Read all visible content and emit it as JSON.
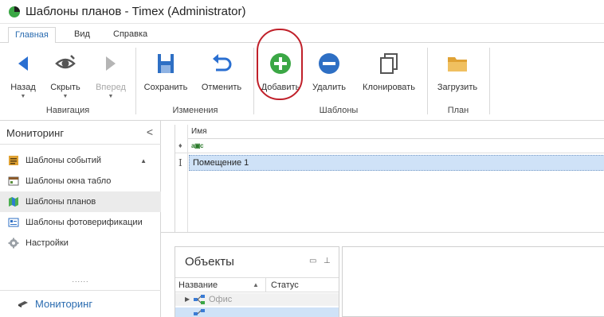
{
  "window": {
    "title": "Шаблоны планов - Timex (Administrator)"
  },
  "menu": {
    "tabs": [
      "Главная",
      "Вид",
      "Справка"
    ],
    "active": "Главная"
  },
  "ribbon": {
    "groups": [
      {
        "label": "Навигация",
        "buttons": [
          {
            "label": "Назад",
            "icon": "arrow-left-icon",
            "enabled": true,
            "dropdown": true
          },
          {
            "label": "Скрыть",
            "icon": "eye-hide-icon",
            "enabled": true,
            "dropdown": true
          },
          {
            "label": "Вперед",
            "icon": "arrow-right-icon",
            "enabled": false,
            "dropdown": true
          }
        ]
      },
      {
        "label": "Изменения",
        "buttons": [
          {
            "label": "Сохранить",
            "icon": "save-icon",
            "enabled": true
          },
          {
            "label": "Отменить",
            "icon": "undo-icon",
            "enabled": true
          }
        ]
      },
      {
        "label": "Шаблоны",
        "buttons": [
          {
            "label": "Добавить",
            "icon": "add-circle-icon",
            "enabled": true,
            "highlighted": true
          },
          {
            "label": "Удалить",
            "icon": "remove-circle-icon",
            "enabled": true
          },
          {
            "label": "Клонировать",
            "icon": "clone-icon",
            "enabled": true
          }
        ]
      },
      {
        "label": "План",
        "buttons": [
          {
            "label": "Загрузить",
            "icon": "folder-open-icon",
            "enabled": true
          }
        ]
      }
    ]
  },
  "sidebar": {
    "title": "Мониторинг",
    "collapse_glyph": "<",
    "items": [
      {
        "label": "Шаблоны событий",
        "icon": "event-templates-icon",
        "expandable": true
      },
      {
        "label": "Шаблоны окна табло",
        "icon": "board-templates-icon"
      },
      {
        "label": "Шаблоны планов",
        "icon": "plan-templates-icon",
        "selected": true
      },
      {
        "label": "Шаблоны фотоверификации",
        "icon": "photo-verification-icon"
      },
      {
        "label": "Настройки",
        "icon": "settings-icon"
      }
    ],
    "grip": "......",
    "footer": {
      "label": "Мониторинг",
      "icon": "monitor-icon"
    }
  },
  "grid": {
    "column_header": "Имя",
    "filter_icon": "filter-pin-icon",
    "filter_type": "abc-text-filter-icon",
    "rows": [
      {
        "name": "Помещение 1",
        "editing": true
      }
    ]
  },
  "objects_panel": {
    "title": "Объекты",
    "columns": [
      "Название",
      "Статус"
    ],
    "rows": [
      {
        "name": "Офис",
        "status": ""
      },
      {
        "name": "",
        "status": "",
        "selected": true
      }
    ]
  },
  "colors": {
    "accent": "#2b6cb0",
    "nav_arrow": "#2a6fd1",
    "add_green": "#3ba745",
    "remove_blue": "#2e6fc4",
    "highlight_ring": "#c0202a",
    "selection": "#cfe2f7"
  }
}
